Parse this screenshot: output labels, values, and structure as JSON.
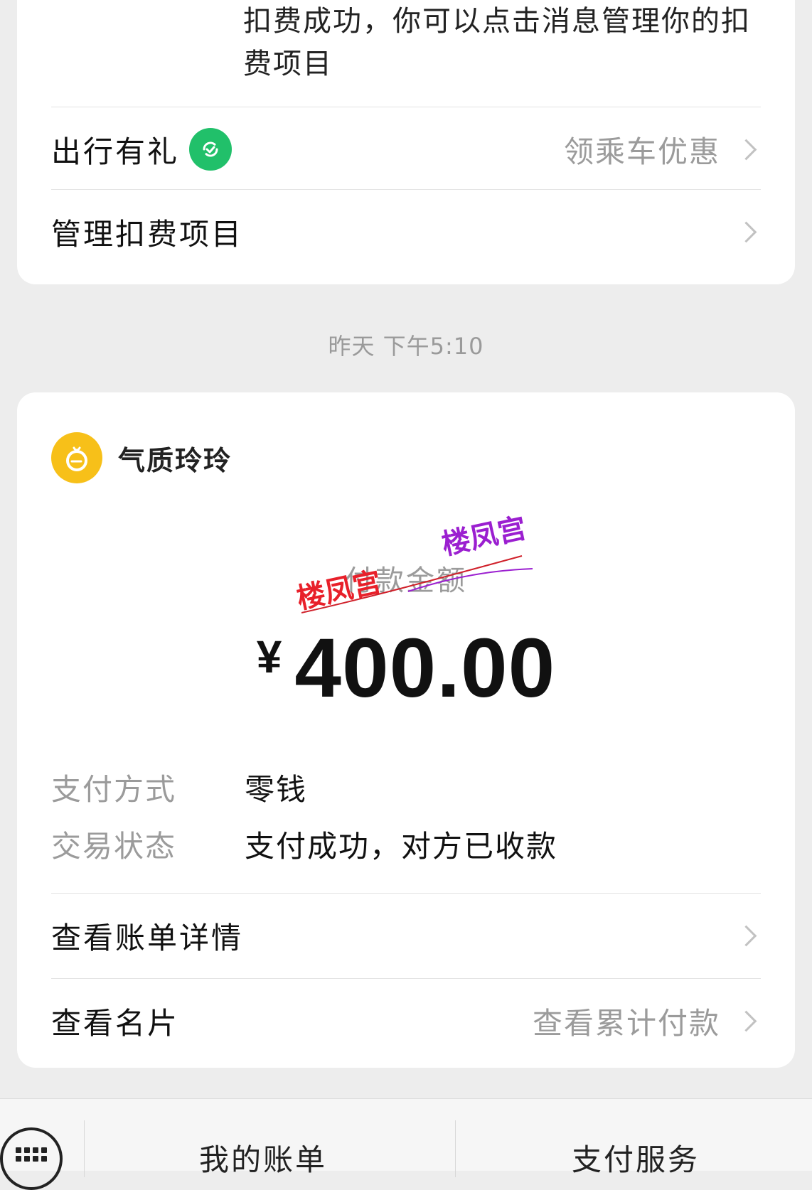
{
  "top_card": {
    "message_text": "扣费成功，你可以点击消息管理你的扣费项目",
    "rows": [
      {
        "label": "出行有礼",
        "hint": "领乘车优惠"
      },
      {
        "label": "管理扣费项目",
        "hint": ""
      }
    ]
  },
  "timestamp": "昨天 下午5:10",
  "payment_card": {
    "merchant_name": "气质玲玲",
    "amount_label": "付款金额",
    "currency": "¥",
    "amount": "400.00",
    "details": [
      {
        "key": "支付方式",
        "value": "零钱"
      },
      {
        "key": "交易状态",
        "value": "支付成功，对方已收款"
      }
    ],
    "rows": [
      {
        "label": "查看账单详情",
        "hint": ""
      },
      {
        "label": "查看名片",
        "hint": "查看累计付款"
      }
    ],
    "watermarks": [
      "楼凤宫",
      "楼凤宫"
    ]
  },
  "bottom_bar": {
    "tabs": [
      "我的账单",
      "支付服务"
    ]
  },
  "colors": {
    "background": "#ededed",
    "card": "#ffffff",
    "green_badge": "#21c06a",
    "merchant_avatar": "#f7c019",
    "watermark_red": "#e8202a",
    "watermark_purple": "#9b1fd0"
  },
  "icons": [
    "refresh-badge-icon",
    "merchant-avatar-icon",
    "chevron-right-icon",
    "keyboard-icon"
  ]
}
